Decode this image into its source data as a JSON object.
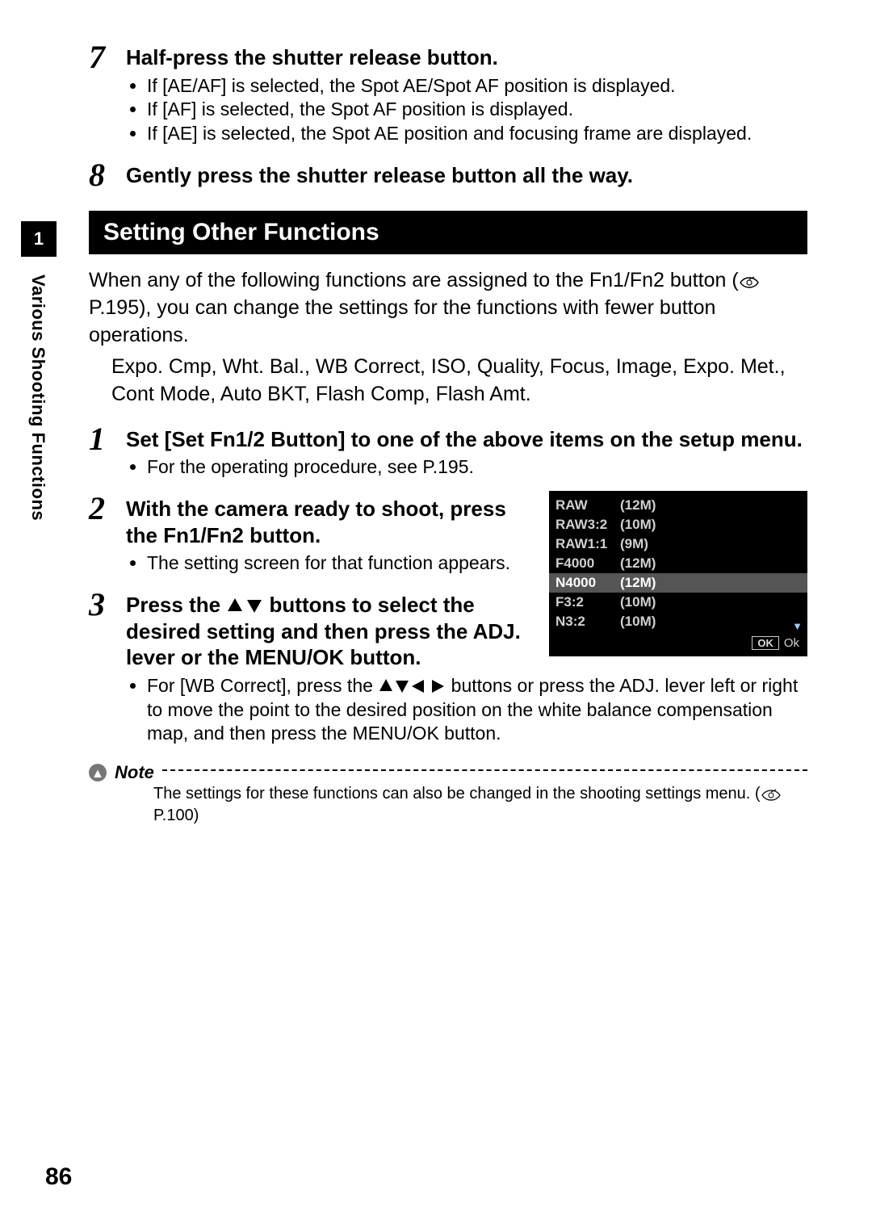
{
  "sidebar": {
    "tab_number": "1",
    "section_label": "Various Shooting Functions"
  },
  "page_number": "86",
  "step7": {
    "num": "7",
    "title": "Half-press the shutter release button.",
    "bullets": [
      "If [AE/AF] is selected, the Spot AE/Spot AF position is displayed.",
      "If [AF] is selected, the Spot AF position is displayed.",
      "If [AE] is selected, the Spot AE position and focusing frame are displayed."
    ]
  },
  "step8": {
    "num": "8",
    "title": "Gently press the shutter release button all the way."
  },
  "section_title": "Setting Other Functions",
  "intro_line1": "When any of the following functions are assigned to the Fn1/Fn2 button (",
  "intro_ref": "P.195",
  "intro_line2": "), you can change the settings for the functions with fewer button operations.",
  "intro_list": "Expo. Cmp, Wht. Bal., WB Correct, ISO, Quality, Focus, Image, Expo. Met., Cont Mode, Auto BKT, Flash Comp, Flash Amt.",
  "s1": {
    "num": "1",
    "title": "Set [Set Fn1/2 Button] to one of the above items on the setup menu.",
    "bullet": "For the operating procedure, see P.195."
  },
  "s2": {
    "num": "2",
    "title": "With the camera ready to shoot, press the Fn1/Fn2 button.",
    "bullet": "The setting screen for that function appears."
  },
  "s3": {
    "num": "3",
    "title_a": "Press the ",
    "title_b": " buttons to select the desired setting and then press the ADJ. lever or the MENU/OK button.",
    "bullet_a": "For [WB Correct], press the ",
    "bullet_b": " buttons or press the ADJ. lever left or right to move the point to the desired position on the white balance compensation map, and then press the MENU/OK button."
  },
  "lcd": {
    "rows": [
      {
        "c1": "RAW",
        "c2": "(12M)"
      },
      {
        "c1": "RAW3:2",
        "c2": "(10M)"
      },
      {
        "c1": "RAW1:1",
        "c2": "(9M)"
      },
      {
        "c1": "F4000",
        "c2": "(12M)"
      },
      {
        "c1": "N4000",
        "c2": "(12M)",
        "selected": true
      },
      {
        "c1": "F3:2",
        "c2": "(10M)"
      },
      {
        "c1": "N3:2",
        "c2": "(10M)"
      }
    ],
    "ok_badge": "OK",
    "ok_label": "Ok"
  },
  "note": {
    "label": "Note",
    "text_a": "The settings for these functions can also be changed in the shooting settings menu. (",
    "ref": "P.100",
    "text_b": ")"
  }
}
